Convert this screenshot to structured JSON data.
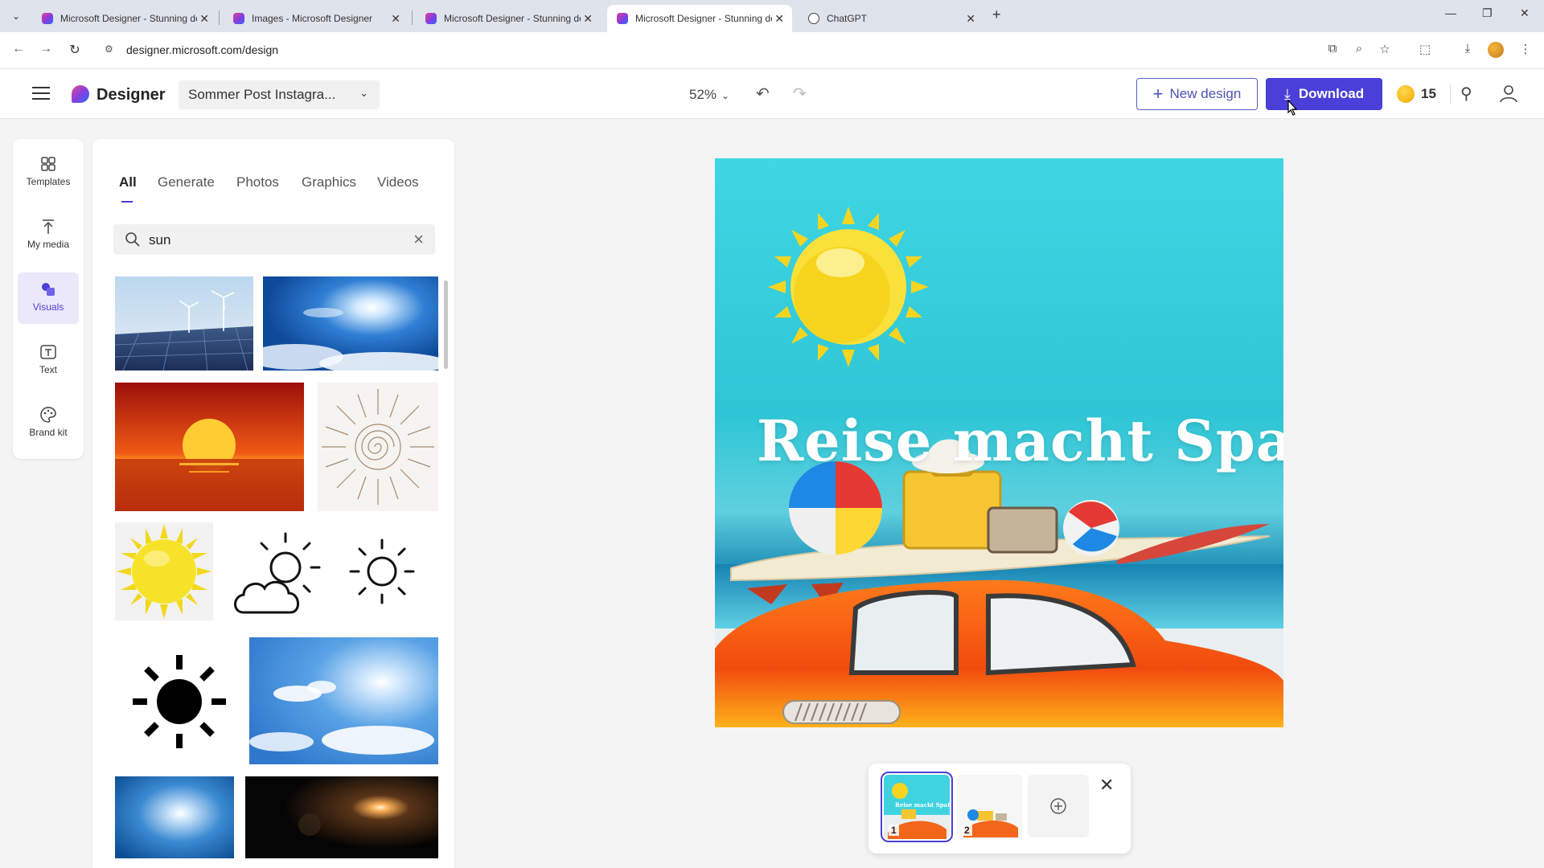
{
  "browser": {
    "tabs": [
      {
        "title": "Microsoft Designer - Stunning designs in a flash",
        "icon": "designer-icon"
      },
      {
        "title": "Images - Microsoft Designer",
        "icon": "designer-icon"
      },
      {
        "title": "Microsoft Designer - Stunning designs in a flash",
        "icon": "designer-icon"
      },
      {
        "title": "Microsoft Designer - Stunning designs in a flash",
        "icon": "designer-icon",
        "active": true
      },
      {
        "title": "ChatGPT",
        "icon": "chatgpt-icon"
      }
    ],
    "url": "designer.microsoft.com/design"
  },
  "header": {
    "brand": "Designer",
    "doc_name": "Sommer Post Instagra...",
    "zoom": "52%",
    "new_design_label": "New design",
    "download_label": "Download",
    "credits": "15"
  },
  "rail": {
    "items": [
      {
        "label": "Templates",
        "icon": "templates-icon"
      },
      {
        "label": "My media",
        "icon": "upload-icon"
      },
      {
        "label": "Visuals",
        "icon": "visuals-icon",
        "active": true
      },
      {
        "label": "Text",
        "icon": "text-icon"
      },
      {
        "label": "Brand kit",
        "icon": "palette-icon"
      }
    ]
  },
  "visuals_panel": {
    "tabs": [
      "All",
      "Generate",
      "Photos",
      "Graphics",
      "Videos"
    ],
    "active_tab": "All",
    "search_value": "sun"
  },
  "canvas": {
    "title_text": "Reise macht Spaß"
  },
  "pages": {
    "items": [
      {
        "number": "1",
        "selected": true
      },
      {
        "number": "2"
      }
    ]
  },
  "colors": {
    "accent": "#4a3fd8",
    "canvas_sky": "#3fd6e3"
  }
}
